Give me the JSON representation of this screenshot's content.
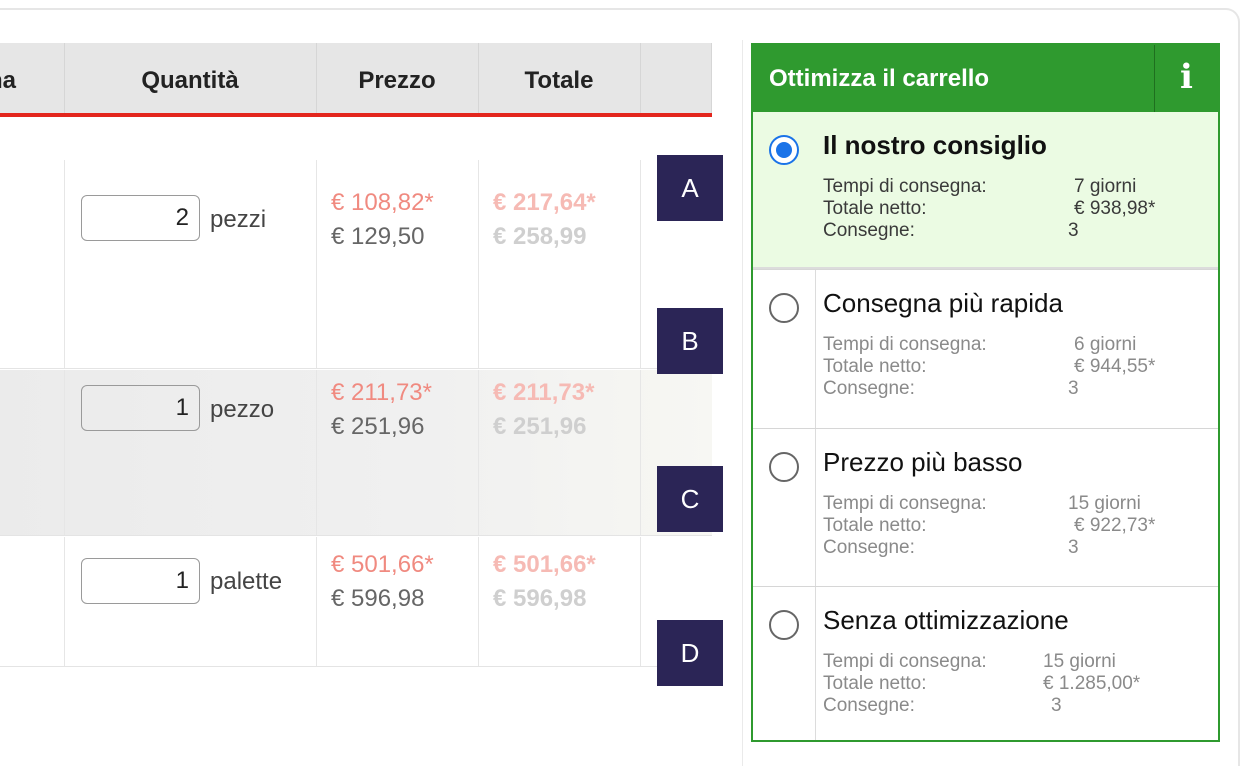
{
  "table": {
    "headers": [
      "na",
      "Quantità",
      "Prezzo",
      "Totale",
      ""
    ],
    "rows": [
      {
        "qty": "2",
        "unit": "pezzi",
        "price_net": "€ 108,82*",
        "price_gross": "€ 129,50",
        "total_net": "€ 217,64*",
        "total_gross": "€ 258,99"
      },
      {
        "qty": "1",
        "unit": "pezzo",
        "price_net": "€ 211,73*",
        "price_gross": "€ 251,96",
        "total_net": "€ 211,73*",
        "total_gross": "€ 251,96"
      },
      {
        "qty": "1",
        "unit": "palette",
        "price_net": "€ 501,66*",
        "price_gross": "€ 596,98",
        "total_net": "€ 501,66*",
        "total_gross": "€ 596,98"
      }
    ]
  },
  "markers": [
    "A",
    "B",
    "C",
    "D"
  ],
  "panel": {
    "title": "Ottimizza il carrello",
    "info_icon": "i",
    "labels": {
      "delivery_time": "Tempi di consegna:",
      "net_total": "Totale netto:",
      "deliveries": "Consegne:"
    },
    "options": [
      {
        "title": "Il nostro consiglio",
        "selected": true,
        "delivery_time": "7 giorni",
        "net_total": "€ 938,98*",
        "deliveries": "3"
      },
      {
        "title": "Consegna più rapida",
        "selected": false,
        "delivery_time": "6 giorni",
        "net_total": "€ 944,55*",
        "deliveries": "3"
      },
      {
        "title": "Prezzo più basso",
        "selected": false,
        "delivery_time": "15 giorni",
        "net_total": "€ 922,73*",
        "deliveries": "3"
      },
      {
        "title": "Senza ottimizzazione",
        "selected": false,
        "delivery_time": "15 giorni",
        "net_total": "€ 1.285,00*",
        "deliveries": "3"
      }
    ]
  },
  "colors": {
    "accent_green": "#2f9a2f",
    "header_underline": "#e3261d",
    "marker_bg": "#2b2556",
    "radio_selected": "#1a73e8"
  }
}
